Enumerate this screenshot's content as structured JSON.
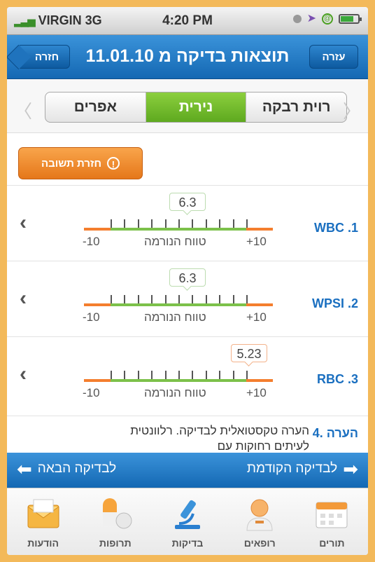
{
  "status_bar": {
    "carrier": "VIRGIN 3G",
    "time": "4:20 PM"
  },
  "nav": {
    "back_label": "חזרה",
    "title": "תוצאות בדיקה מ 11.01.10",
    "help_label": "עזרה"
  },
  "segments": [
    {
      "label": "אפרים",
      "active": false
    },
    {
      "label": "נירית",
      "active": true
    },
    {
      "label": "רוית רבקה",
      "active": false
    }
  ],
  "alert_button": {
    "label": "חזרת תשובה"
  },
  "results": [
    {
      "name": "WBC .1",
      "value": "6.3",
      "min_label": "-10",
      "max_label": "+10",
      "norm_label": "טווח הנורמה",
      "status": "normal"
    },
    {
      "name": "WPSI .2",
      "value": "6.3",
      "min_label": "-10",
      "max_label": "+10",
      "norm_label": "טווח הנורמה",
      "status": "normal"
    },
    {
      "name": "RBC .3",
      "value": "5.23",
      "min_label": "-10",
      "max_label": "+10",
      "norm_label": "טווח הנורמה",
      "status": "warn"
    }
  ],
  "note": {
    "name": "4. הערה",
    "text": "הערה טקסטואלית לבדיקה. רלוונטית לעיתים רחוקות עם"
  },
  "pager": {
    "prev_label": "לבדיקה הקודמת",
    "next_label": "לבדיקה הבאה"
  },
  "tabs": [
    {
      "label": "הודעות",
      "icon": "envelope-icon"
    },
    {
      "label": "תרופות",
      "icon": "pills-icon"
    },
    {
      "label": "בדיקות",
      "icon": "microscope-icon"
    },
    {
      "label": "רופאים",
      "icon": "doctor-icon"
    },
    {
      "label": "תורים",
      "icon": "calendar-icon"
    }
  ],
  "colors": {
    "nav_blue": "#1b74c4",
    "active_green": "#6cb52a",
    "alert_orange": "#ee8a2a",
    "range_orange": "#f47e2e",
    "range_green": "#7cc14a"
  }
}
